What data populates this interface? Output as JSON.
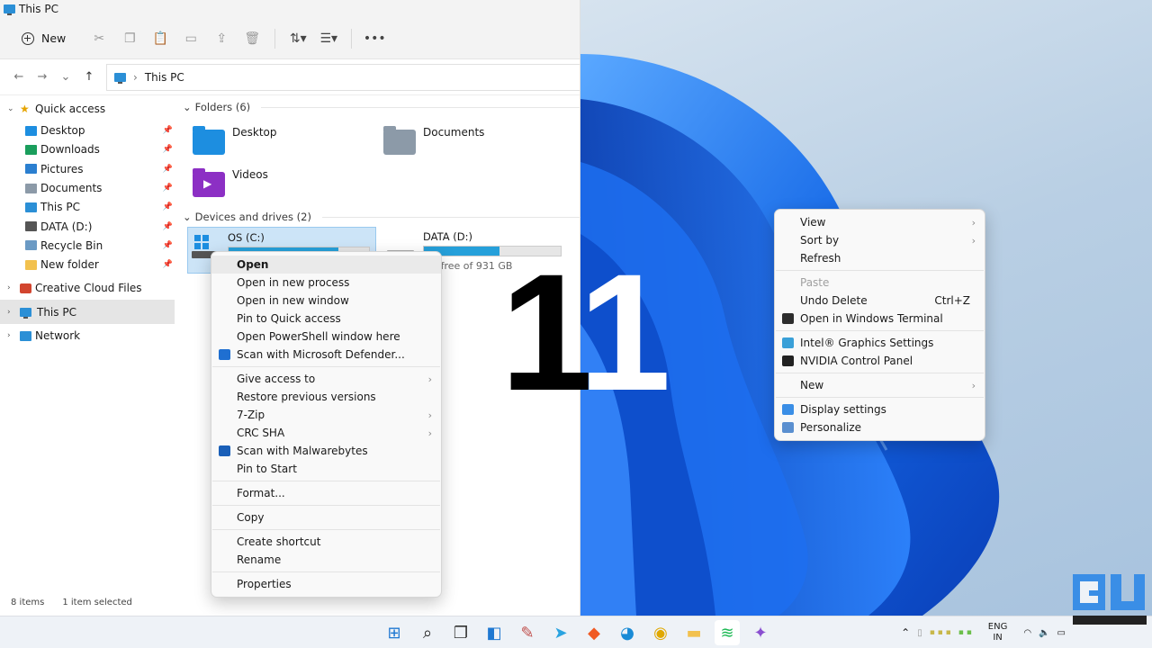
{
  "window": {
    "title": "This PC"
  },
  "toolbar": {
    "new_label": "New"
  },
  "address": {
    "path": "This PC"
  },
  "sidebar": {
    "quick_access": "Quick access",
    "pinned": [
      {
        "label": "Desktop",
        "icon": "desktop-icon",
        "color": "#1d8ee0"
      },
      {
        "label": "Downloads",
        "icon": "download-icon",
        "color": "#1a9e5c"
      },
      {
        "label": "Pictures",
        "icon": "pictures-icon",
        "color": "#2b7fd0"
      },
      {
        "label": "Documents",
        "icon": "documents-icon",
        "color": "#8c9aa8"
      },
      {
        "label": "This PC",
        "icon": "pc-icon",
        "color": "#2b8fd6"
      },
      {
        "label": "DATA (D:)",
        "icon": "drive-icon",
        "color": "#555555"
      },
      {
        "label": "Recycle Bin",
        "icon": "recycle-bin-icon",
        "color": "#6b9ac4"
      },
      {
        "label": "New folder",
        "icon": "folder-icon",
        "color": "#f2c14e"
      }
    ],
    "creative_cloud": "Creative Cloud Files",
    "this_pc": "This PC",
    "network": "Network"
  },
  "content": {
    "folders_header": "Folders (6)",
    "folders": [
      "Desktop",
      "Documents",
      "Videos"
    ],
    "drives_header": "Devices and drives (2)",
    "drives": [
      {
        "name": "OS (C:)",
        "used_fraction": 0.78,
        "free_text": ""
      },
      {
        "name": "DATA (D:)",
        "used_fraction": 0.55,
        "free_text": "GB free of 931 GB"
      }
    ]
  },
  "status": {
    "items": "8 items",
    "selected": "1 item selected"
  },
  "file_menu": {
    "items": [
      {
        "label": "Open",
        "bold": true
      },
      {
        "label": "Open in new process"
      },
      {
        "label": "Open in new window"
      },
      {
        "label": "Pin to Quick access"
      },
      {
        "label": "Open PowerShell window here"
      },
      {
        "label": "Scan with Microsoft Defender...",
        "icon": "defender-shield-icon"
      },
      {
        "sep": true
      },
      {
        "label": "Give access to",
        "submenu": true
      },
      {
        "label": "Restore previous versions"
      },
      {
        "label": "7-Zip",
        "submenu": true
      },
      {
        "label": "CRC SHA",
        "submenu": true
      },
      {
        "label": "Scan with Malwarebytes",
        "icon": "malwarebytes-icon"
      },
      {
        "label": "Pin to Start"
      },
      {
        "sep": true
      },
      {
        "label": "Format..."
      },
      {
        "sep": true
      },
      {
        "label": "Copy"
      },
      {
        "sep": true
      },
      {
        "label": "Create shortcut"
      },
      {
        "label": "Rename"
      },
      {
        "sep": true
      },
      {
        "label": "Properties"
      }
    ]
  },
  "desktop_menu": {
    "items": [
      {
        "label": "View",
        "submenu": true
      },
      {
        "label": "Sort by",
        "submenu": true
      },
      {
        "label": "Refresh"
      },
      {
        "sep": true
      },
      {
        "label": "Paste",
        "disabled": true
      },
      {
        "label": "Undo Delete",
        "shortcut": "Ctrl+Z"
      },
      {
        "label": "Open in Windows Terminal",
        "icon": "terminal-icon"
      },
      {
        "sep": true
      },
      {
        "label": "Intel® Graphics Settings",
        "icon": "intel-graphics-icon"
      },
      {
        "label": "NVIDIA Control Panel",
        "icon": "nvidia-icon"
      },
      {
        "sep": true
      },
      {
        "label": "New",
        "submenu": true
      },
      {
        "sep": true
      },
      {
        "label": "Display settings",
        "icon": "display-icon"
      },
      {
        "label": "Personalize",
        "icon": "personalize-icon"
      }
    ]
  },
  "overlay": {
    "digit1": "1",
    "digit2": "1"
  },
  "taskbar": {
    "apps": [
      "start-icon",
      "search-icon",
      "task-view-icon",
      "widgets-icon",
      "paint-icon",
      "telegram-icon",
      "brave-icon",
      "edge-icon",
      "chrome-icon",
      "file-explorer-icon",
      "spotify-icon",
      "app-icon"
    ],
    "lang_top": "ENG",
    "lang_bottom": "IN"
  }
}
